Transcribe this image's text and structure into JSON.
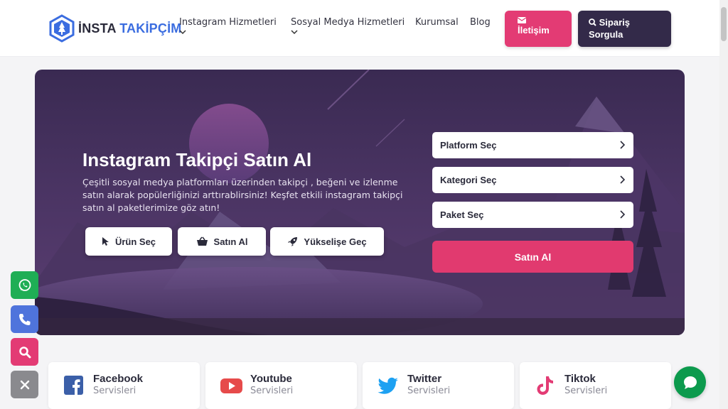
{
  "logo": {
    "part1": "İNSTA",
    "part2": "TAKİPÇİM"
  },
  "nav": {
    "items": [
      {
        "label": "Instagram Hizmetleri",
        "dropdown": true
      },
      {
        "label": "Sosyal Medya Hizmetleri",
        "dropdown": true
      },
      {
        "label": "Kurumsal",
        "dropdown": false
      },
      {
        "label": "Blog",
        "dropdown": false
      }
    ],
    "contact_label": "İletişim",
    "order_label_1": "Sipariş",
    "order_label_2": "Sorgula"
  },
  "hero": {
    "title": "Instagram Takipçi Satın Al",
    "description": "Çeşitli sosyal medya platformları üzerinden takipçi , beğeni ve izlenme satın alarak popülerliğinizi arttırablirsiniz! Keşfet etkili instagram takipçi satın al paketlerimize göz atın!",
    "buttons": {
      "select_product": "Ürün Seç",
      "buy": "Satın Al",
      "rise": "Yükselişe Geç"
    },
    "form": {
      "platform": "Platform Seç",
      "category": "Kategori Seç",
      "package": "Paket Seç",
      "submit": "Satın Al"
    }
  },
  "services": [
    {
      "name": "Facebook",
      "sub": "Servisleri",
      "icon": "facebook-icon"
    },
    {
      "name": "Youtube",
      "sub": "Servisleri",
      "icon": "youtube-icon"
    },
    {
      "name": "Twitter",
      "sub": "Servisleri",
      "icon": "twitter-icon"
    },
    {
      "name": "Tiktok",
      "sub": "Servisleri",
      "icon": "tiktok-icon"
    }
  ],
  "side_buttons": [
    "whatsapp-icon",
    "phone-icon",
    "search-icon",
    "close-icon"
  ],
  "colors": {
    "primary_pink": "#e33b74",
    "dark_purple": "#332a49",
    "brand_blue": "#3b6de0",
    "whatsapp_green": "#0c9a4d"
  }
}
